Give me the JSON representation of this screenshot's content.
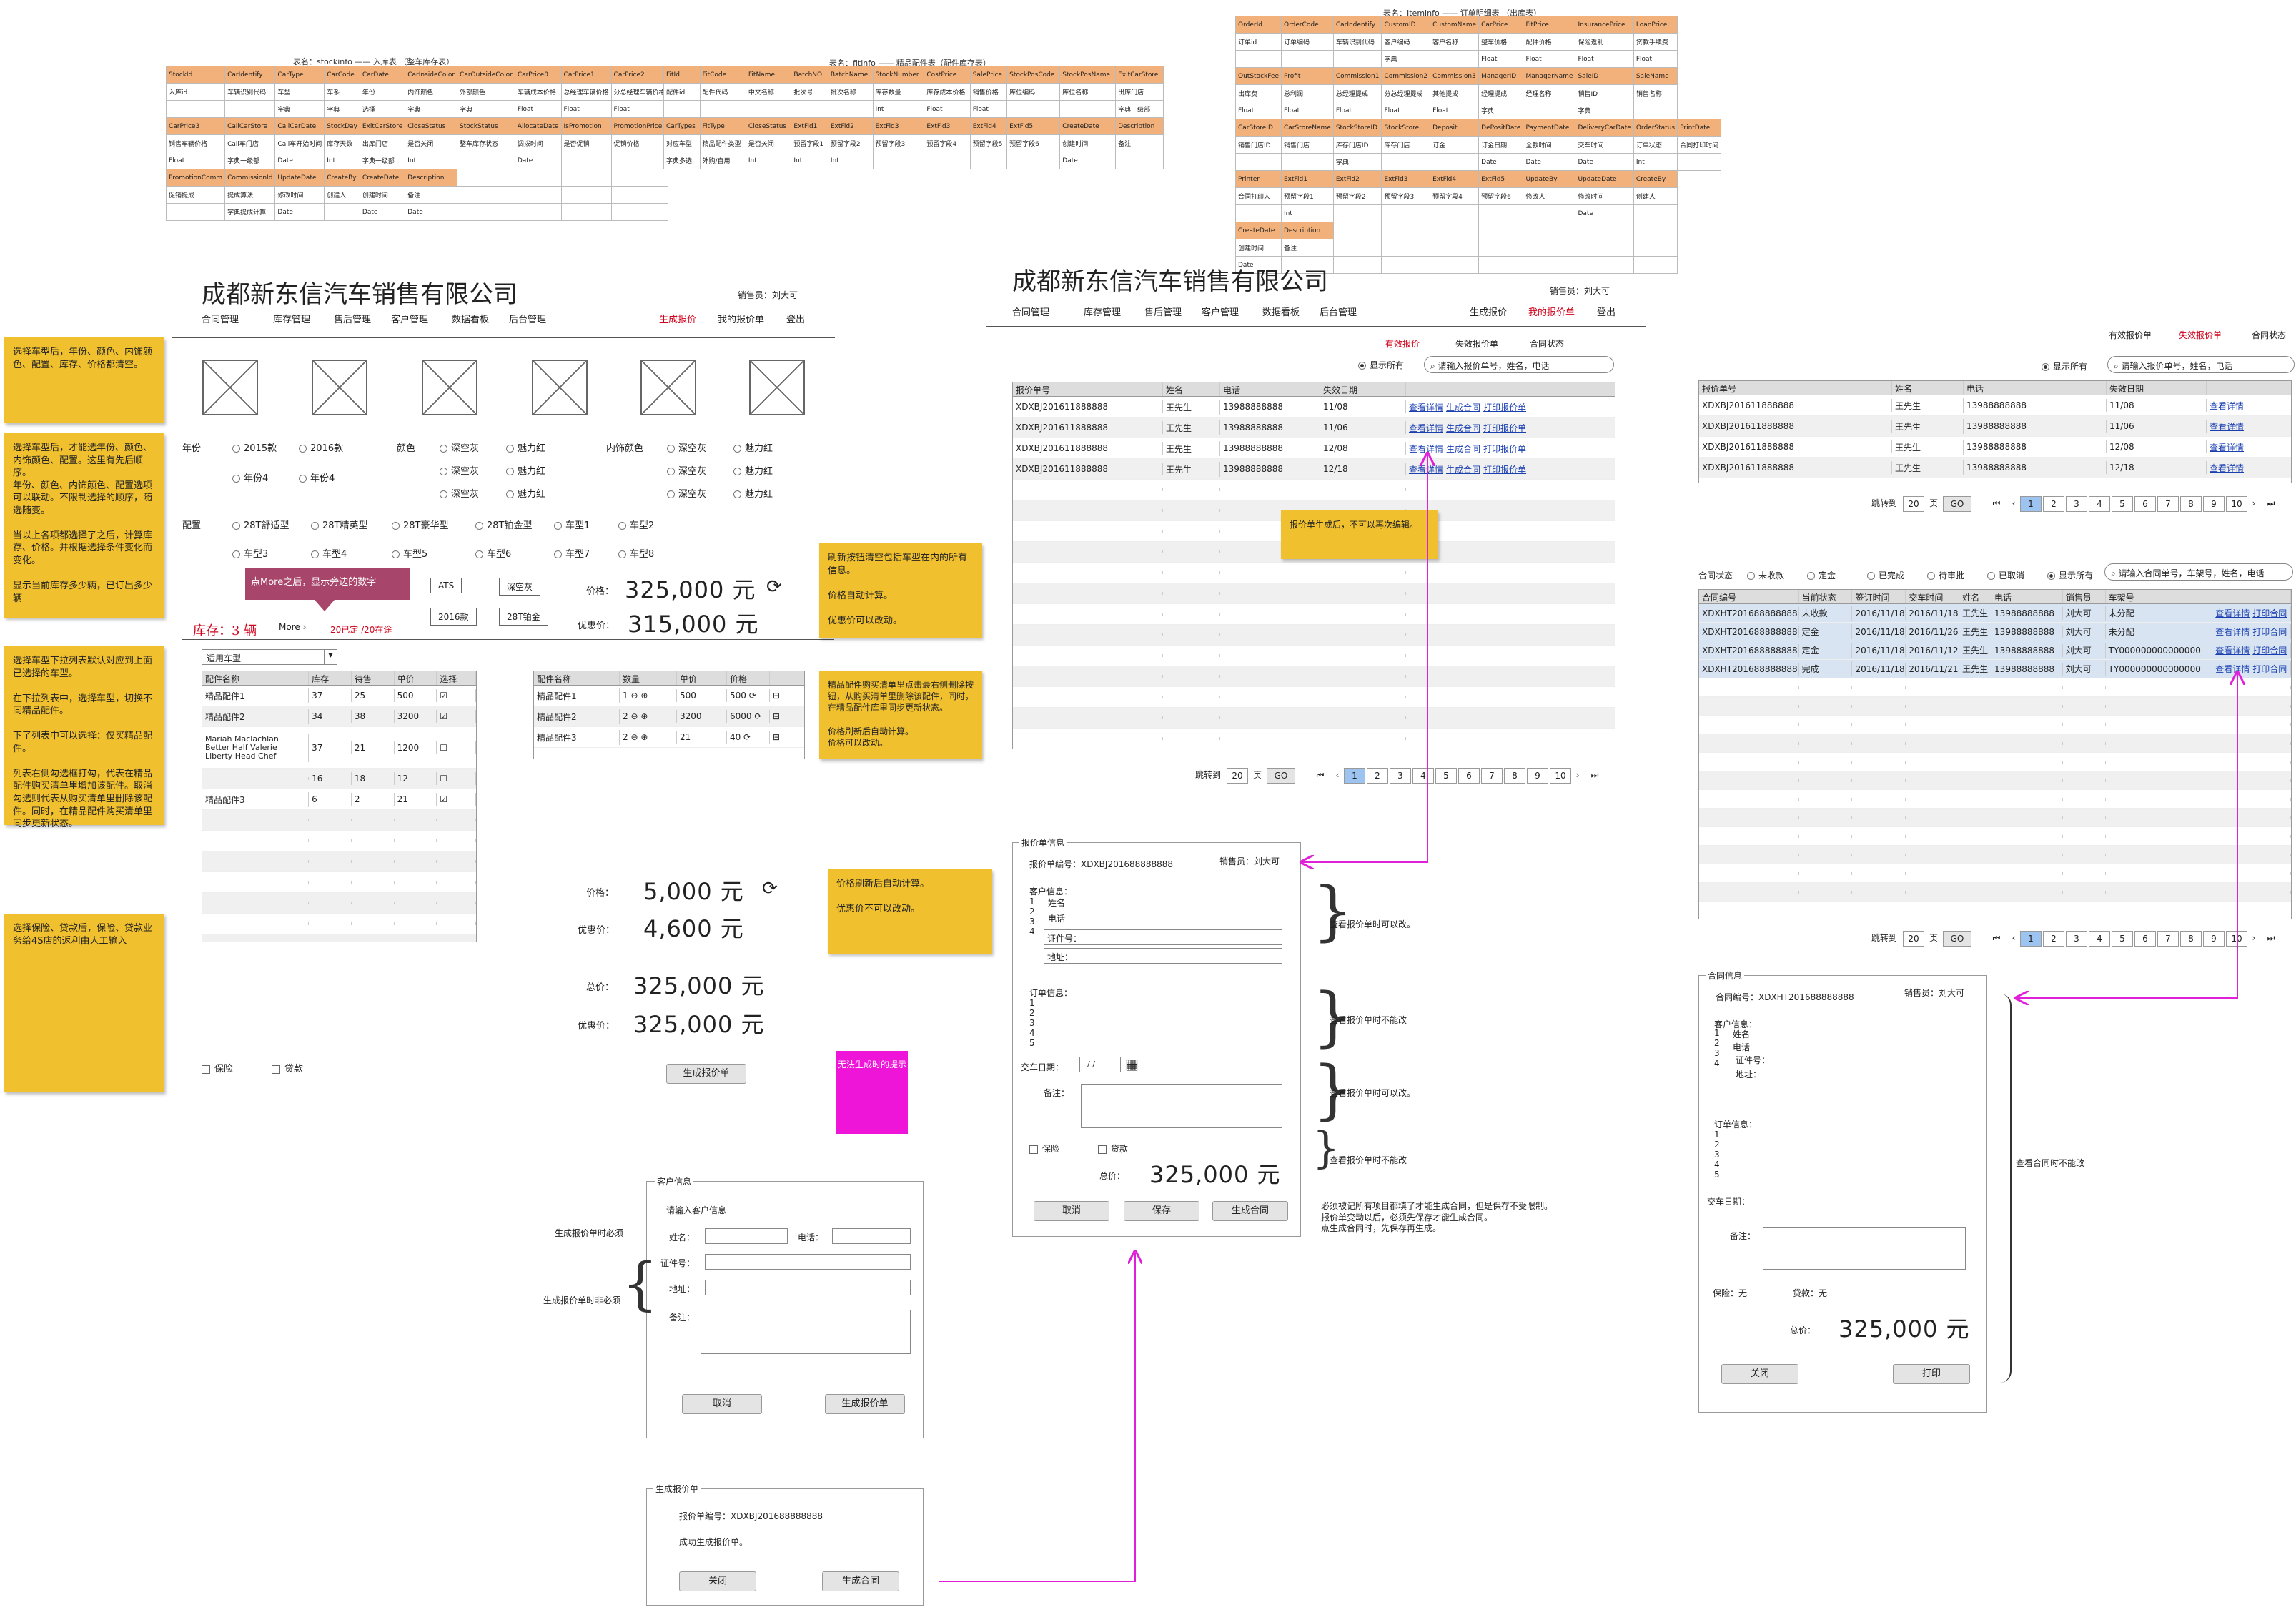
{
  "tables": [
    {
      "caption": "表名：stockinfo —— 入库表 （整车库存表）",
      "rows": [
        {
          "h": true,
          "cells": [
            "StockId",
            "CarIdentify",
            "CarType",
            "CarCode",
            "CarDate",
            "CarInsideColor",
            "CarOutsideColor",
            "CarPrice0",
            "CarPrice1",
            "CarPrice2"
          ]
        },
        {
          "cells": [
            "入库id",
            "车辆识别代码",
            "车型",
            "车系",
            "年份",
            "内饰颜色",
            "外部颜色",
            "车辆成本价格",
            "总经理车辆价格",
            "分总经理车辆价格"
          ]
        },
        {
          "cells": [
            "",
            "",
            "字典",
            "字典",
            "选择",
            "字典",
            "字典",
            "Float",
            "Float",
            "Float"
          ]
        },
        {
          "h": true,
          "cells": [
            "CarPrice3",
            "CallCarStore",
            "CallCarDate",
            "StockDay",
            "ExitCarStore",
            "CloseStatus",
            "StockStatus",
            "AllocateDate",
            "IsPromotion",
            "PromotionPrice"
          ]
        },
        {
          "cells": [
            "销售车辆价格",
            "Call车门店",
            "Call车开始时间",
            "库存天数",
            "出库门店",
            "是否关闭",
            "整车库存状态",
            "调拨时间",
            "是否促销",
            "促销价格"
          ]
        },
        {
          "cells": [
            "Float",
            "字典一级部",
            "Date",
            "Int",
            "字典一级部",
            "Int",
            "",
            "Date",
            "",
            ""
          ]
        },
        {
          "h": true,
          "cells": [
            "PromotionComm",
            "CommissionId",
            "UpdateDate",
            "CreateBy",
            "CreateDate",
            "Description",
            "",
            "",
            "",
            ""
          ]
        },
        {
          "cells": [
            "促销提成",
            "提成算法",
            "修改时间",
            "创建人",
            "创建时间",
            "备注",
            "",
            "",
            "",
            ""
          ]
        },
        {
          "cells": [
            "",
            "字典提成计算",
            "Date",
            "",
            "Date",
            "Date",
            "",
            "",
            "",
            ""
          ]
        }
      ]
    },
    {
      "caption": "表名：fitinfo —— 精品配件表（配件库存表）",
      "rows": [
        {
          "h": true,
          "cells": [
            "FitId",
            "FitCode",
            "FitName",
            "BatchNO",
            "BatchName",
            "StockNumber",
            "CostPrice",
            "SalePrice",
            "StockPosCode",
            "StockPosName",
            "ExitCarStore"
          ]
        },
        {
          "cells": [
            "配件id",
            "配件代码",
            "中文名称",
            "批次号",
            "批次名称",
            "库存数量",
            "库存成本价格",
            "销售价格",
            "库位编码",
            "库位名称",
            "出库门店"
          ]
        },
        {
          "cells": [
            "",
            "",
            "",
            "",
            "",
            "Int",
            "Float",
            "Float",
            "",
            "",
            "字典一级部"
          ]
        },
        {
          "h": true,
          "cells": [
            "CarTypes",
            "FitType",
            "CloseStatus",
            "ExtFid1",
            "ExtFid2",
            "ExtFid3",
            "ExtFid3",
            "ExtFid4",
            "ExtFid5",
            "CreateDate",
            "Description"
          ]
        },
        {
          "cells": [
            "对应车型",
            "精品配件类型",
            "是否关闭",
            "预留字段1",
            "预留字段2",
            "预留字段3",
            "预留字段4",
            "预留字段5",
            "预留字段6",
            "创建时间",
            "备注"
          ]
        },
        {
          "cells": [
            "字典多选",
            "外购/自用",
            "Int",
            "Int",
            "Int",
            "",
            "",
            "",
            "",
            "Date",
            ""
          ]
        }
      ]
    },
    {
      "caption": "表名：Iteminfo —— 订单明细表 （出库表）",
      "rows": [
        {
          "h": true,
          "cells": [
            "OrderId",
            "OrderCode",
            "CarIndentify",
            "CustomID",
            "CustomName",
            "CarPrice",
            "FitPrice",
            "InsurancePrice",
            "LoanPrice"
          ]
        },
        {
          "cells": [
            "订单id",
            "订单编码",
            "车辆识别代码",
            "客户编码",
            "客户名称",
            "整车价格",
            "配件价格",
            "保险返利",
            "贷款手续费"
          ]
        },
        {
          "cells": [
            "",
            "",
            "",
            "字典",
            "",
            "Float",
            "Float",
            "Float",
            "Float"
          ]
        },
        {
          "h": true,
          "cells": [
            "OutStockFee",
            "Profit",
            "Commission1",
            "Commission2",
            "Commission3",
            "ManagerID",
            "ManagerName",
            "SaleID",
            "SaleName"
          ]
        },
        {
          "cells": [
            "出库费",
            "总利润",
            "总经理提成",
            "分总经理提成",
            "其他提成",
            "经理提成",
            "经理名称",
            "销售ID",
            "销售名称"
          ]
        },
        {
          "cells": [
            "Float",
            "Float",
            "Float",
            "Float",
            "Float",
            "字典",
            "",
            "字典",
            ""
          ]
        },
        {
          "h": true,
          "cells": [
            "CarStoreID",
            "CarStoreName",
            "StockStoreID",
            "StockStore",
            "Deposit",
            "DePositDate",
            "PaymentDate",
            "DeliveryCarDate",
            "OrderStatus",
            "PrintDate"
          ]
        },
        {
          "cells": [
            "销售门店ID",
            "销售门店",
            "库存门店ID",
            "库存门店",
            "订金",
            "订金日期",
            "全款时间",
            "交车时间",
            "订单状态",
            "合同打印时间"
          ]
        },
        {
          "cells": [
            "",
            "",
            "字典",
            "",
            "",
            "Date",
            "Date",
            "Date",
            "Int",
            ""
          ]
        },
        {
          "h": true,
          "cells": [
            "Printer",
            "ExtFid1",
            "ExtFid2",
            "ExtFid3",
            "ExtFid4",
            "ExtFid5",
            "UpdateBy",
            "UpdateDate",
            "CreateBy"
          ]
        },
        {
          "cells": [
            "合同打印人",
            "预留字段1",
            "预留字段2",
            "预留字段3",
            "预留字段4",
            "预留字段6",
            "修改人",
            "修改时间",
            "创建人"
          ]
        },
        {
          "cells": [
            "",
            "Int",
            "",
            "",
            "",
            "",
            "",
            "Date",
            ""
          ]
        },
        {
          "h": true,
          "cells": [
            "CreateDate",
            "Description",
            "",
            "",
            "",
            "",
            "",
            "",
            ""
          ]
        },
        {
          "cells": [
            "创建时间",
            "备注",
            "",
            "",
            "",
            "",
            "",
            "",
            ""
          ]
        },
        {
          "cells": [
            "Date",
            "",
            "",
            "",
            "",
            "",
            "",
            "",
            ""
          ]
        }
      ]
    }
  ],
  "company": "成都新东信汽车销售有限公司",
  "salesperson": "销售员：刘大可",
  "nav": [
    "合同管理",
    "库存管理",
    "售后管理",
    "客户管理",
    "数据看板",
    "后台管理"
  ],
  "nav_right_1": [
    "生成报价",
    "我的报价单",
    "登出"
  ],
  "nav_right_2": [
    "生成报价",
    "我的报价单",
    "登出"
  ],
  "stickies": [
    "选择车型后，年份、颜色、内饰颜色、配置、库存、价格都清空。",
    "选择车型后，才能选年份、颜色、内饰颜色、配置。这里有先后顺序。\n年份、颜色、内饰颜色、配置选项可以联动。不限制选择的顺序，随选随变。\n\n当以上各项都选择了之后，计算库存、价格。并根据选择条件变化而变化。\n\n显示当前库存多少辆，已订出多少辆",
    "选择车型下拉列表默认对应到上面已选择的车型。\n\n在下拉列表中，选择车型，切换不同精品配件。\n\n下了列表中可以选择：仅买精品配件。\n\n列表右侧勾选框打勾，代表在精品配件购买清单里增加该配件。取消勾选则代表从购买清单里删除该配件。同时，在精品配件购买清单里同步更新状态。",
    "选择保险、贷款后，保险、贷款业务给4S店的返利由人工输入",
    "刷新按钮清空包括车型在内的所有信息。\n\n价格自动计算。\n\n优惠价可以改动。",
    "精品配件购买清单里点击最右侧删除按钮，从购买清单里删除该配件，同时，在精品配件库里同步更新状态。\n\n价格刷新后自动计算。\n价格可以改动。",
    "价格刷新后自动计算。\n\n优惠价不可以改动。",
    "报价单生成后，不可以再次编辑。"
  ],
  "pink_note": "无法生成时的提示",
  "purple_callout": "点More之后，显示旁边的数字",
  "quote": {
    "year_label": "年份",
    "years": [
      "2015款",
      "2016款",
      "年份4",
      "年份4"
    ],
    "color_label": "颜色",
    "colors": [
      "深空灰",
      "魅力红",
      "深空灰",
      "魅力红",
      "深空灰",
      "魅力红"
    ],
    "inner_label": "内饰颜色",
    "inners": [
      "深空灰",
      "魅力红",
      "深空灰",
      "魅力红",
      "深空灰",
      "魅力红"
    ],
    "config_label": "配置",
    "configs": [
      "28T舒适型",
      "28T精英型",
      "28T豪华型",
      "28T铂金型",
      "车型1",
      "车型2",
      "车型3",
      "车型4",
      "车型5",
      "车型6",
      "车型7",
      "车型8"
    ],
    "tags": [
      "ATS",
      "深空灰",
      "2016款",
      "28T铂金"
    ],
    "stock_label": "库存：3  辆",
    "more": "More",
    "more_detail": "20已定 /20在途",
    "price_label": "价格：",
    "price": "325,000  元",
    "discount_label": "优惠价：",
    "discount": "315,000  元",
    "fit_select": "适用车型",
    "fit_headers": [
      "配件名称",
      "库存",
      "待售",
      "单价",
      "选择"
    ],
    "fit_rows": [
      [
        "精品配件1",
        "37",
        "25",
        "500",
        "☑"
      ],
      [
        "精品配件2",
        "34",
        "38",
        "3200",
        "☑"
      ],
      [
        "Mariah Maclachlan Better Half Valerie Liberty Head Chef",
        "37",
        "21",
        "1200",
        "☐"
      ],
      [
        "",
        "16",
        "18",
        "12",
        "☐"
      ],
      [
        "精品配件3",
        "6",
        "2",
        "21",
        "☑"
      ]
    ],
    "cart_headers": [
      "配件名称",
      "数量",
      "单价",
      "价格"
    ],
    "cart_rows": [
      [
        "精品配件1",
        "1",
        "500",
        "500"
      ],
      [
        "精品配件2",
        "2",
        "3200",
        "6000"
      ],
      [
        "精品配件3",
        "2",
        "21",
        "40"
      ]
    ],
    "fit_price": "5,000  元",
    "fit_discount": "4,600  元",
    "total_label": "总价：",
    "total": "325,000  元",
    "total_discount": "325,000  元",
    "insurance": "保险",
    "loan": "贷款",
    "generate": "生成报价单"
  },
  "list": {
    "tabs": [
      "有效报价",
      "失效报价单",
      "合同状态"
    ],
    "show_all": "显示所有",
    "search_ph": "请输入报价单号，姓名，电话",
    "headers": [
      "报价单号",
      "姓名",
      "电话",
      "失效日期",
      ""
    ],
    "rows": [
      [
        "XDXBJ201611888888",
        "王先生",
        "13988888888",
        "11/08"
      ],
      [
        "XDXBJ201611888888",
        "王先生",
        "13988888888",
        "11/06"
      ],
      [
        "XDXBJ201611888888",
        "王先生",
        "13988888888",
        "12/08"
      ],
      [
        "XDXBJ201611888888",
        "王先生",
        "13988888888",
        "12/18"
      ]
    ],
    "actions": [
      "查看详情",
      "生成合同",
      "打印报价单"
    ],
    "jump": "跳转到",
    "page": "20",
    "page_unit": "页",
    "go": "GO",
    "pages": [
      "1",
      "2",
      "3",
      "4",
      "5",
      "6",
      "7",
      "8",
      "9",
      "10"
    ]
  },
  "quote_detail": {
    "title": "报价单信息",
    "code": "报价单编号：XDXBJ201688888888",
    "sales": "销售员：刘大可",
    "cust": "客户信息：",
    "nums": [
      "1",
      "2",
      "3",
      "4"
    ],
    "name": "姓名",
    "phone": "电话",
    "id": "证件号：",
    "addr": "地址：",
    "order": "订单信息：",
    "onums": [
      "1",
      "2",
      "3",
      "4",
      "5"
    ],
    "delivery": "交车日期：",
    "date": "/ /",
    "remark": "备注：",
    "insurance": "保险",
    "loan": "贷款",
    "total_label": "总价：",
    "total": "325,000  元",
    "btns": [
      "取消",
      "保存",
      "生成合同"
    ]
  },
  "braces": [
    "查看报价单时可以改。",
    "查看报价单时不能改",
    "查看报价单时可以改。",
    "查看报价单时不能改"
  ],
  "save_note": "必须被记所有项目都填了才能生成合同，但是保存不受限制。\n报价单变动以后，必须先保存才能生成合同。\n点生成合同时，先保存再生成。",
  "cust_dialog": {
    "title": "客户信息",
    "prompt": "请输入客户信息",
    "name": "姓名：",
    "phone": "电话：",
    "id": "证件号：",
    "addr": "地址：",
    "remark": "备注：",
    "cancel": "取消",
    "gen": "生成报价单",
    "req": "生成报价单时必须",
    "opt": "生成报价单时非必须"
  },
  "gen_dialog": {
    "title": "生成报价单",
    "code": "报价单编号：XDXBJ201688888888",
    "msg": "成功生成报价单。",
    "close": "关闭",
    "contract": "生成合同"
  },
  "right": {
    "tabs": [
      "有效报价单",
      "失效报价单",
      "合同状态"
    ],
    "show_all": "显示所有",
    "search_ph": "请输入报价单号，姓名，电话",
    "headers": [
      "报价单号",
      "姓名",
      "电话",
      "失效日期",
      ""
    ],
    "rows": [
      [
        "XDXBJ201611888888",
        "王先生",
        "13988888888",
        "11/08"
      ],
      [
        "XDXBJ201611888888",
        "王先生",
        "13988888888",
        "11/06"
      ],
      [
        "XDXBJ201611888888",
        "王先生",
        "13988888888",
        "12/08"
      ],
      [
        "XDXBJ201611888888",
        "王先生",
        "13988888888",
        "12/18"
      ]
    ],
    "action": "查看详情",
    "jump": "跳转到",
    "page": "20",
    "page_unit": "页",
    "go": "GO",
    "pages": [
      "1",
      "2",
      "3",
      "4",
      "5",
      "6",
      "7",
      "8",
      "9",
      "10"
    ],
    "status_label": "合同状态",
    "statuses": [
      "未收款",
      "定金",
      "已完成",
      "待审批",
      "已取消",
      "显示所有"
    ],
    "search2_ph": "请输入合同单号，车架号，姓名，电话",
    "c_headers": [
      "合同编号",
      "当前状态",
      "签订时间",
      "交车时间",
      "姓名",
      "电话",
      "销售员",
      "车架号",
      ""
    ],
    "c_rows": [
      [
        "XDXHT201688888888",
        "未收款",
        "2016/11/18",
        "2016/11/18",
        "王先生",
        "13988888888",
        "刘大可",
        "未分配"
      ],
      [
        "XDXHT201688888888",
        "定金",
        "2016/11/18",
        "2016/11/26",
        "王先生",
        "13988888888",
        "刘大可",
        "未分配"
      ],
      [
        "XDXHT201688888888",
        "定金",
        "2016/11/18",
        "2016/11/12",
        "王先生",
        "13988888888",
        "刘大可",
        "TY000000000000000"
      ],
      [
        "XDXHT201688888888",
        "完成",
        "2016/11/18",
        "2016/11/21",
        "王先生",
        "13988888888",
        "刘大可",
        "TY000000000000000"
      ]
    ],
    "c_actions": [
      "查看详情",
      "打印合同"
    ]
  },
  "contract": {
    "title": "合同信息",
    "code": "合同编号：XDXHT201688888888",
    "sales": "销售员：刘大可",
    "cust": "客户信息：",
    "nums": [
      "1",
      "2",
      "3",
      "4"
    ],
    "name": "姓名",
    "phone": "电话",
    "id": "证件号：",
    "addr": "地址：",
    "order": "订单信息：",
    "onums": [
      "1",
      "2",
      "3",
      "4",
      "5"
    ],
    "delivery": "交车日期：",
    "remark": "备注：",
    "ins": "保险：无",
    "loan": "贷款：无",
    "total_label": "总价：",
    "total": "325,000  元",
    "close": "关闭",
    "print": "打印",
    "brace": "查看合同时不能改"
  }
}
